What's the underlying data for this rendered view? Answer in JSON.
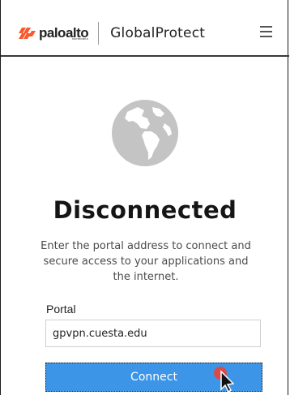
{
  "header": {
    "brand_name": "paloalto",
    "brand_subtext": "NETWORKS",
    "product_name": "GlobalProtect",
    "menu_icon": "hamburger-menu-icon"
  },
  "main": {
    "status_icon": "globe-icon",
    "status_title": "Disconnected",
    "status_message": "Enter the portal address to connect and secure access to your applications and the internet.",
    "portal_label": "Portal",
    "portal_value": "gpvpn.cuesta.edu",
    "connect_label": "Connect"
  },
  "colors": {
    "brand_accent": "#fa582d",
    "primary_button": "#3d95e8",
    "globe": "#bfbfbf"
  }
}
